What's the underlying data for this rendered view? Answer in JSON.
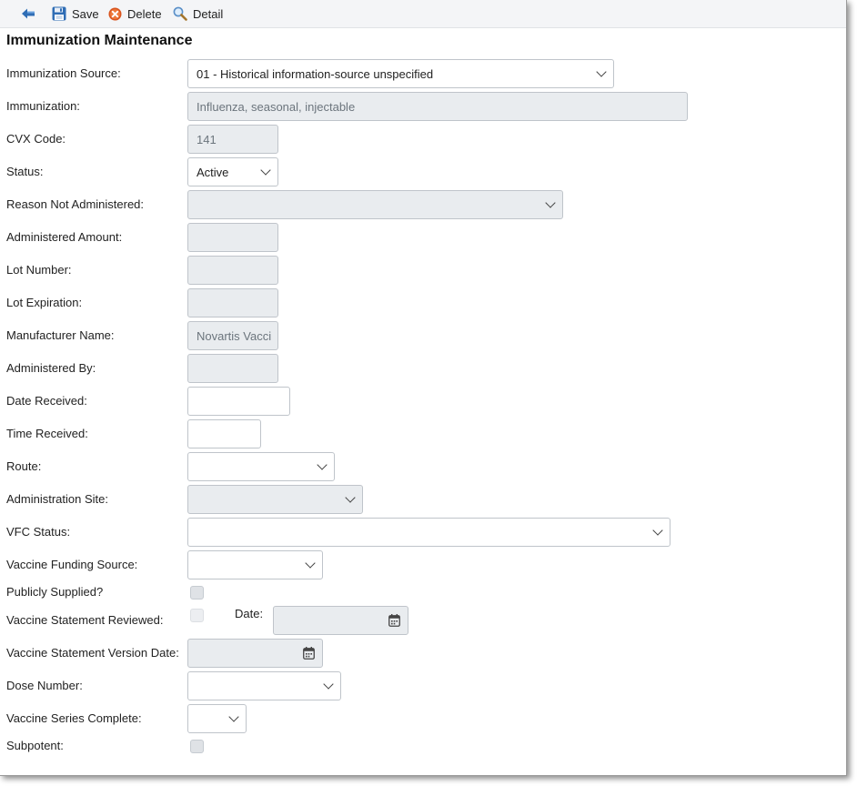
{
  "toolbar": {
    "back_label": "",
    "save_label": "Save",
    "delete_label": "Delete",
    "detail_label": "Detail"
  },
  "page": {
    "title": "Immunization Maintenance"
  },
  "labels": {
    "immunization_source": "Immunization Source:",
    "immunization": "Immunization:",
    "cvx_code": "CVX Code:",
    "status": "Status:",
    "reason_not_administered": "Reason Not Administered:",
    "administered_amount": "Administered Amount:",
    "lot_number": "Lot Number:",
    "lot_expiration": "Lot Expiration:",
    "manufacturer_name": "Manufacturer Name:",
    "administered_by": "Administered By:",
    "date_received": "Date Received:",
    "time_received": "Time Received:",
    "route": "Route:",
    "administration_site": "Administration Site:",
    "vfc_status": "VFC Status:",
    "vaccine_funding_source": "Vaccine Funding Source:",
    "publicly_supplied": "Publicly Supplied?",
    "vaccine_statement_reviewed": "Vaccine Statement Reviewed:",
    "date": "Date:",
    "vaccine_statement_version_date": "Vaccine Statement Version Date:",
    "dose_number": "Dose Number:",
    "vaccine_series_complete": "Vaccine Series Complete:",
    "subpotent": "Subpotent:"
  },
  "values": {
    "immunization_source": "01 - Historical information-source unspecified",
    "immunization": "Influenza, seasonal, injectable",
    "cvx_code": "141",
    "status": "Active",
    "reason_not_administered": "",
    "administered_amount": "",
    "lot_number": "",
    "lot_expiration": "",
    "manufacturer_name": "Novartis Vacci",
    "administered_by": "",
    "date_received": "",
    "time_received": "",
    "route": "",
    "administration_site": "",
    "vfc_status": "",
    "vaccine_funding_source": "",
    "statement_date": "",
    "vaccine_statement_version_date": "",
    "dose_number": "",
    "vaccine_series_complete": ""
  },
  "checkboxes": {
    "publicly_supplied": false,
    "vaccine_statement_reviewed": false,
    "subpotent": false
  },
  "colors": {
    "accent": "#2f6db5",
    "delete": "#d9541e",
    "disabled_bg": "#e9ecef",
    "border": "#bfc4ca"
  },
  "icons": {
    "back": "arrow-left-icon",
    "save": "floppy-disk-icon",
    "delete": "delete-x-icon",
    "detail": "magnifier-icon",
    "calendar": "calendar-icon",
    "dropdown": "chevron-down-icon"
  }
}
